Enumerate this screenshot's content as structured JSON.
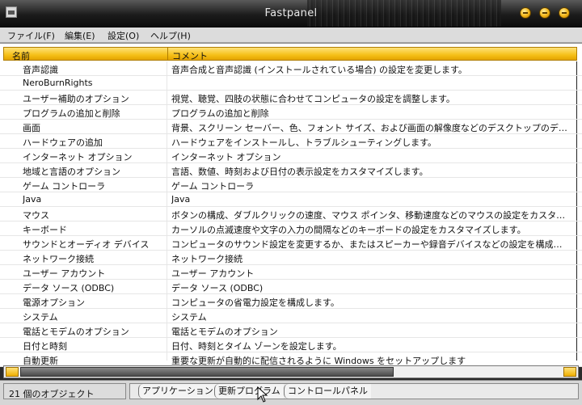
{
  "window": {
    "title": "Fastpanel"
  },
  "menu": [
    {
      "label": "ファイル(F)"
    },
    {
      "label": "編集(E)"
    },
    {
      "label": "設定(O)"
    },
    {
      "label": "ヘルプ(H)"
    }
  ],
  "list": {
    "columns": [
      "名前",
      "コメント"
    ],
    "rows": [
      {
        "name": "音声認識",
        "comment": "音声合成と音声認識 (インストールされている場合) の設定を変更します。"
      },
      {
        "name": "NeroBurnRights",
        "comment": ""
      },
      {
        "name": "ユーザー補助のオプション",
        "comment": "視覚、聴覚、四肢の状態に合わせてコンピュータの設定を調整します。"
      },
      {
        "name": "プログラムの追加と削除",
        "comment": "プログラムの追加と削除"
      },
      {
        "name": "画面",
        "comment": "背景、スクリーン セーバー、色、フォント サイズ、および画面の解像度などのデスクトップのデ…"
      },
      {
        "name": "ハードウェアの追加",
        "comment": "ハードウェアをインストールし、トラブルシューティングします。"
      },
      {
        "name": "インターネット オプション",
        "comment": "インターネット オプション"
      },
      {
        "name": "地域と言語のオプション",
        "comment": "言語、数値、時刻および日付の表示設定をカスタマイズします。"
      },
      {
        "name": "ゲーム コントローラ",
        "comment": "ゲーム コントローラ"
      },
      {
        "name": "Java",
        "comment": "Java"
      },
      {
        "name": "マウス",
        "comment": "ボタンの構成、ダブルクリックの速度、マウス ポインタ、移動速度などのマウスの設定をカスタマ…"
      },
      {
        "name": "キーボード",
        "comment": "カーソルの点滅速度や文字の入力の間隔などのキーボードの設定をカスタマイズします。"
      },
      {
        "name": "サウンドとオーディオ デバイス",
        "comment": "コンピュータのサウンド設定を変更するか、またはスピーカーや録音デバイスなどの設定を構成…"
      },
      {
        "name": "ネットワーク接続",
        "comment": "ネットワーク接続"
      },
      {
        "name": "ユーザー アカウント",
        "comment": "ユーザー アカウント"
      },
      {
        "name": "データ ソース (ODBC)",
        "comment": "データ ソース (ODBC)"
      },
      {
        "name": "電源オプション",
        "comment": "コンピュータの省電力設定を構成します。"
      },
      {
        "name": "システム",
        "comment": "システム"
      },
      {
        "name": "電話とモデムのオプション",
        "comment": "電話とモデムのオプション"
      },
      {
        "name": "日付と時刻",
        "comment": "日付、時刻とタイム ゾーンを設定します。"
      },
      {
        "name": "自動更新",
        "comment": "重要な更新が自動的に配信されるように Windows をセットアップします"
      }
    ]
  },
  "status": {
    "object_count": "21 個のオブジェクト",
    "breadcrumbs": [
      {
        "label": "アプリケーション"
      },
      {
        "label": "更新プログラム"
      },
      {
        "label": "コントロールパネル"
      }
    ]
  },
  "colors": {
    "accent": "#f6c018",
    "titlebar": "#1c1c1c"
  }
}
